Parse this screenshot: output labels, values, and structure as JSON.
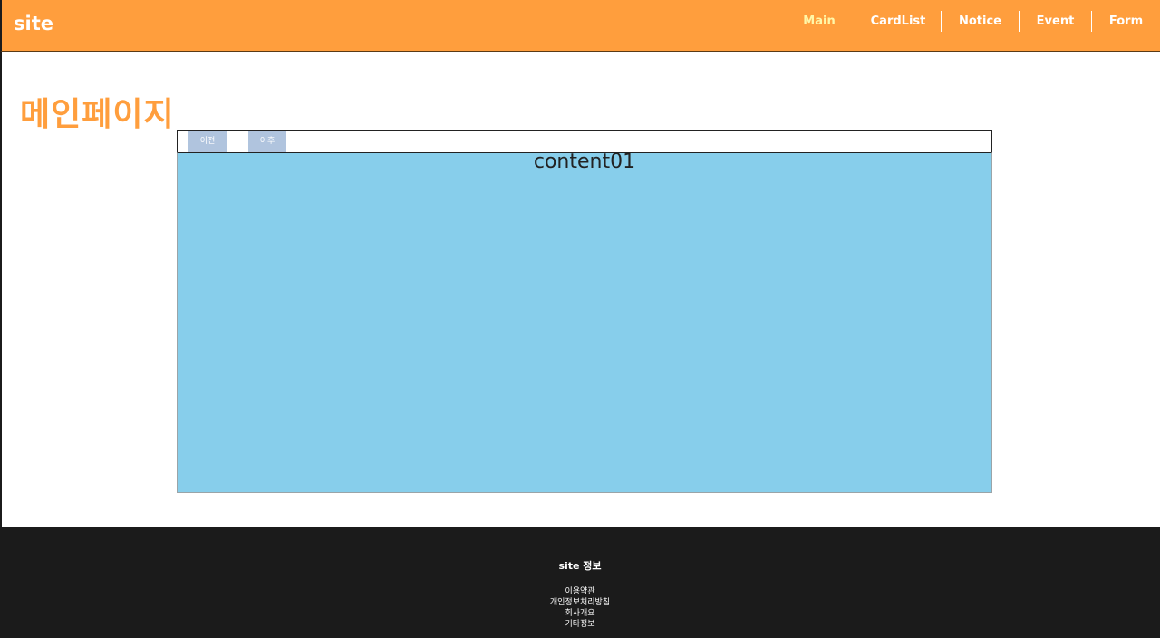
{
  "header": {
    "logo": "site",
    "nav": [
      {
        "label": "Main",
        "active": true
      },
      {
        "label": "CardList"
      },
      {
        "label": "Notice"
      },
      {
        "label": "Event"
      },
      {
        "label": "Form"
      }
    ]
  },
  "main": {
    "title": "메인페이지",
    "slider": {
      "prev_label": "이전",
      "next_label": "이후",
      "slide_label": "content01"
    }
  },
  "footer": {
    "title": "site 정보",
    "links": [
      "이용약관",
      "개인정보처리방침",
      "회사개요",
      "기타정보"
    ]
  },
  "colors": {
    "header_bg": "#ff9e3d",
    "title_color": "#ff9e3d",
    "slide_bg": "#87ceeb",
    "button_bg": "#b0c4de",
    "footer_bg": "#1b1b1b",
    "active_nav": "#fff7a8"
  }
}
